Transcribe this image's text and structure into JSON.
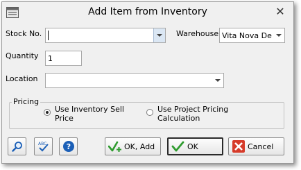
{
  "window": {
    "title": "Add Item from Inventory",
    "close_glyph": "✕"
  },
  "fields": {
    "stock_no": {
      "label": "Stock No.",
      "value": ""
    },
    "warehouse": {
      "label": "Warehouse",
      "value": "Vita Nova De"
    },
    "quantity": {
      "label": "Quantity",
      "value": "1"
    },
    "location": {
      "label": "Location",
      "value": ""
    }
  },
  "pricing": {
    "label": "Pricing",
    "options": [
      {
        "line1": "Use Inventory Sell",
        "line2": "Price",
        "selected": true
      },
      {
        "line1": "Use Project Pricing",
        "line2": "Calculation",
        "selected": false
      }
    ]
  },
  "buttons": {
    "ok_add": "OK, Add",
    "ok": "OK",
    "cancel": "Cancel"
  },
  "icons": {
    "app": "inventory-window-icon",
    "search": "magnifier-icon",
    "spell": "spell-check-icon",
    "help": "help-icon",
    "ok_add": "green-check-plus-icon",
    "ok": "green-check-icon",
    "cancel": "red-x-icon"
  },
  "colors": {
    "accent_blue": "#1b5fb7",
    "ok_green": "#2e9b2e",
    "cancel_red": "#d63b2a"
  }
}
